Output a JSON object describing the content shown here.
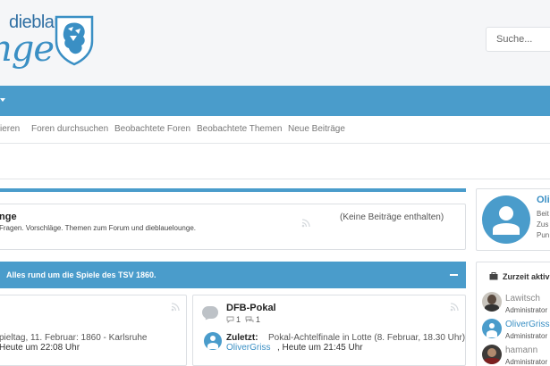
{
  "header": {
    "logo_line1": "dieblaue",
    "logo_line2": "nge",
    "search_placeholder": "Suche..."
  },
  "subnav": {
    "items": [
      "ieren",
      "Foren durchsuchen",
      "Beobachtete Foren",
      "Beobachtete Themen",
      "Neue Beiträge"
    ]
  },
  "lounge": {
    "title": "nge",
    "description": "Fragen. Vorschläge. Themen zum Forum und dieblauelounge.",
    "empty_label": "(Keine Beiträge enthalten)"
  },
  "category": {
    "title": "Alles rund um die Spiele des TSV 1860."
  },
  "forum_left": {
    "last_thread": "pieltag, 11. Februar: 1860 - Karlsruhe",
    "last_meta": "Heute um 22:08 Uhr"
  },
  "forum_right": {
    "title": "DFB-Pokal",
    "threads_count": "1",
    "posts_count": "1",
    "last_prefix": "Zuletzt:",
    "last_thread": "Pokal-Achtelfinale in Lotte (8. Februar, 18.30 Uhr)",
    "last_author": "OliverGriss",
    "last_time": ", Heute um 21:45 Uhr"
  },
  "sidebar": {
    "user": {
      "name": "Oli",
      "meta": [
        "Beit",
        "Zus",
        "Pun"
      ]
    },
    "active_title": "Zurzeit aktiv",
    "active_users": [
      {
        "name": "Lawitsch",
        "role": "Administrator"
      },
      {
        "name": "OliverGriss",
        "role": "Administrator"
      },
      {
        "name": "hamann",
        "role": "Administrator"
      }
    ]
  },
  "colors": {
    "accent": "#4a9ccb",
    "link": "#3a8fc4"
  }
}
